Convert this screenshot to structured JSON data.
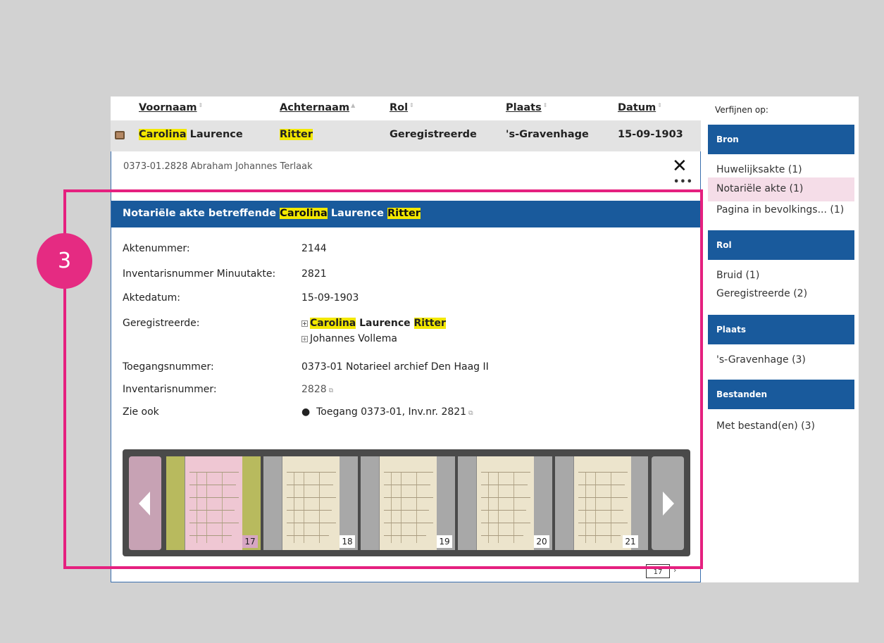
{
  "table": {
    "columns": [
      "Voornaam",
      "Achternaam",
      "Rol",
      "Plaats",
      "Datum"
    ],
    "sort_none": "⇕",
    "sort_asc": "▲",
    "row": {
      "first_name_hl": "Carolina",
      "first_name_rest": " Laurence",
      "last_name": "Ritter",
      "role": "Geregistreerde",
      "place": "'s-Gravenhage",
      "date": "15-09-1903"
    }
  },
  "detail": {
    "reference": "0373-01.2828 Abraham Johannes Terlaak",
    "close": "✕",
    "more": "•••",
    "title_prefix": "Notariële akte betreffende ",
    "title_hl1": "Carolina",
    "title_mid": " Laurence ",
    "title_hl2": "Ritter",
    "fields": {
      "aktenummer_label": "Aktenummer:",
      "aktenummer_value": "2144",
      "inventaris_minuut_label": "Inventarisnummer Minuutakte:",
      "inventaris_minuut_value": "2821",
      "aktedatum_label": "Aktedatum:",
      "aktedatum_value": "15-09-1903",
      "geregistreerde_label": "Geregistreerde:",
      "person1_hl1": "Carolina",
      "person1_mid": " Laurence ",
      "person1_hl2": "Ritter",
      "person2": "Johannes Vollema",
      "toegang_label": "Toegangsnummer:",
      "toegang_value": "0373-01 Notarieel archief Den Haag II",
      "inventaris_label": "Inventarisnummer:",
      "inventaris_value": "2828",
      "zie_ook_label": "Zie ook",
      "zie_ook_value": "Toegang 0373-01, Inv.nr. 2821"
    },
    "carousel": {
      "thumbs": [
        "17",
        "18",
        "19",
        "20",
        "21"
      ],
      "selected": "17"
    },
    "pager": "17"
  },
  "facets": {
    "title": "Verfijnen op:",
    "groups": [
      {
        "name": "Bron",
        "items": [
          "Huwelijksakte (1)",
          "Notariële akte (1)",
          "Pagina in bevolkings... (1)"
        ]
      },
      {
        "name": "Rol",
        "items": [
          "Bruid (1)",
          "Geregistreerde (2)"
        ]
      },
      {
        "name": "Plaats",
        "items": [
          "'s-Gravenhage (3)"
        ]
      },
      {
        "name": "Bestanden",
        "items": [
          "Met bestand(en) (3)"
        ]
      }
    ],
    "active_item": "Notariële akte (1)"
  },
  "annotation": {
    "badge": "3"
  },
  "colors": {
    "brand_blue": "#195a9c",
    "highlight": "#f3e800",
    "annotation": "#e5207f"
  }
}
